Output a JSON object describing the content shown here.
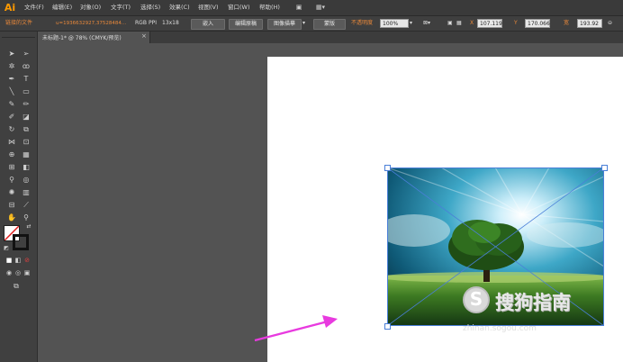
{
  "app": {
    "logo": "Ai"
  },
  "menu": [
    "文件(F)",
    "编辑(E)",
    "对象(O)",
    "文字(T)",
    "选择(S)",
    "效果(C)",
    "视图(V)",
    "窗口(W)",
    "帮助(H)"
  ],
  "control": {
    "left_label": "链接的文件",
    "file_name": "u=1936632927,37528484...",
    "color_mode": "RGB",
    "ppi_label": "PPI",
    "ppi_value": "13x18",
    "embed": "嵌入",
    "edit_original": "编辑原稿",
    "image_trace": "图像描摹",
    "mask": "蒙版",
    "opacity_label": "不透明度",
    "opacity_value": "100%",
    "x_label": "X",
    "x_value": "107.119",
    "y_label": "Y",
    "y_value": "170.066",
    "w_label": "宽",
    "w_value": "193.92"
  },
  "document": {
    "tab_title": "未标题-1* @ 78% (CMYK/预览)",
    "close": "×"
  },
  "watermark": {
    "text": "搜狗指南",
    "url": "zhinan.sogou.com",
    "badge": "S"
  },
  "colors": {
    "arrow": "#e83adf",
    "accent": "#e8883a"
  }
}
